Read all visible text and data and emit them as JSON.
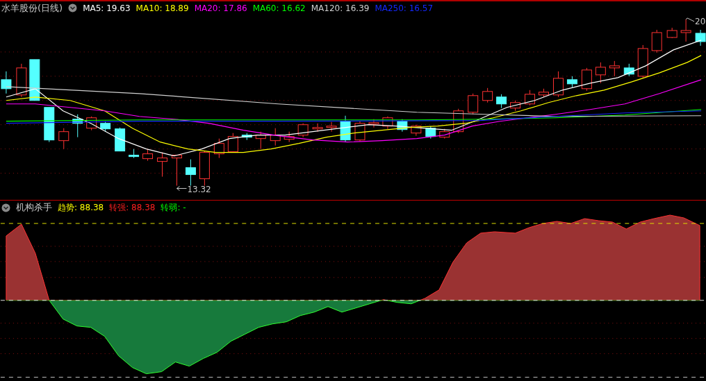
{
  "stock": {
    "title": "水羊股份(日线)",
    "ma_legend": [
      {
        "label": "MA5: 19.63",
        "color": "#ffffff"
      },
      {
        "label": "MA10: 18.89",
        "color": "#ffff00"
      },
      {
        "label": "MA20: 17.86",
        "color": "#ff00ff"
      },
      {
        "label": "MA60: 16.62",
        "color": "#00ff00"
      },
      {
        "label": "MA120: 16.39",
        "color": "#d0d0d0"
      },
      {
        "label": "MA250: 16.57",
        "color": "#1428ff"
      }
    ],
    "high_marker": "20",
    "low_marker": "13.32"
  },
  "indicator": {
    "title": "机构杀手",
    "readings": [
      {
        "label": "趋势: 88.38",
        "color": "#ffff00"
      },
      {
        "label": "转强: 88.38",
        "color": "#ff2020"
      },
      {
        "label": "转弱: -",
        "color": "#00ff00"
      }
    ]
  }
}
